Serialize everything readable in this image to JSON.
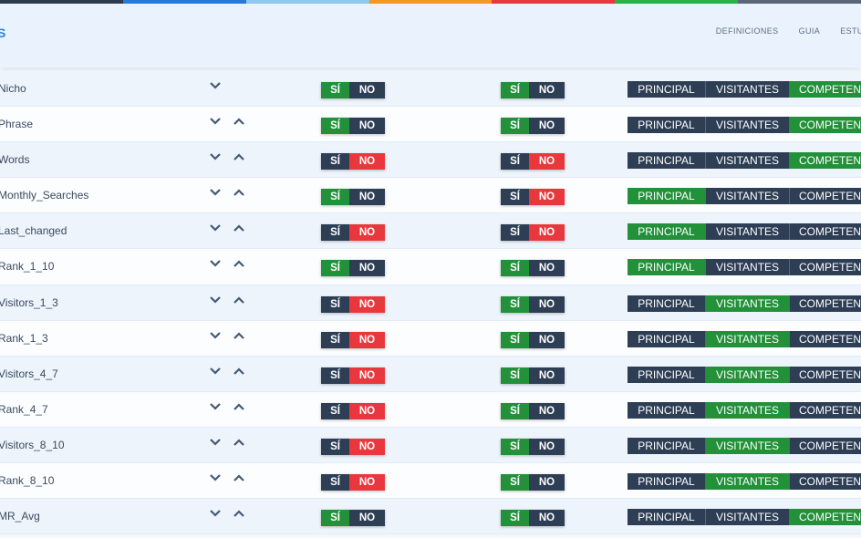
{
  "colors": {
    "bar": [
      "#2e3b4e",
      "#2979d9",
      "#8ec9f0",
      "#f29a1f",
      "#e8383d",
      "#2bb34a",
      "#5b6778"
    ],
    "green": "#22913a",
    "navy": "#2d3e55",
    "red": "#e8383d"
  },
  "header": {
    "logo_fragment": "S",
    "nav": [
      "DEFINICIONES",
      "GUIA",
      "ESTUDIO"
    ]
  },
  "labels": {
    "si": "SÍ",
    "no": "NO",
    "principal": "PRINCIPAL",
    "visitantes": "VISITANTES",
    "competencia": "COMPETEN"
  },
  "rows": [
    {
      "name": "Nicho",
      "up": false,
      "t1": "si",
      "t2": "si",
      "group": "c"
    },
    {
      "name": "Phrase",
      "up": true,
      "t1": "si",
      "t2": "si",
      "group": "c"
    },
    {
      "name": "Words",
      "up": true,
      "t1": "no",
      "t2": "no",
      "group": "c"
    },
    {
      "name": "Monthly_Searches",
      "up": true,
      "t1": "si",
      "t2": "no",
      "group": "p"
    },
    {
      "name": "Last_changed",
      "up": true,
      "t1": "no",
      "t2": "no",
      "group": "p"
    },
    {
      "name": "Rank_1_10",
      "up": true,
      "t1": "si",
      "t2": "si",
      "group": "p"
    },
    {
      "name": "Visitors_1_3",
      "up": true,
      "t1": "no",
      "t2": "si",
      "group": "v"
    },
    {
      "name": "Rank_1_3",
      "up": true,
      "t1": "no",
      "t2": "si",
      "group": "v"
    },
    {
      "name": "Visitors_4_7",
      "up": true,
      "t1": "no",
      "t2": "si",
      "group": "v"
    },
    {
      "name": "Rank_4_7",
      "up": true,
      "t1": "no",
      "t2": "si",
      "group": "v"
    },
    {
      "name": "Visitors_8_10",
      "up": true,
      "t1": "no",
      "t2": "si",
      "group": "v"
    },
    {
      "name": "Rank_8_10",
      "up": true,
      "t1": "no",
      "t2": "si",
      "group": "v"
    },
    {
      "name": "MR_Avg",
      "up": true,
      "t1": "si",
      "t2": "si",
      "group": "c"
    }
  ]
}
